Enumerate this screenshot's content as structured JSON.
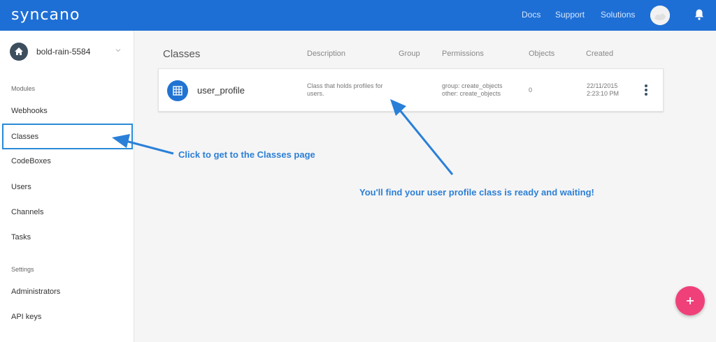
{
  "topbar": {
    "logo": "syncano",
    "nav": [
      "Docs",
      "Support",
      "Solutions"
    ]
  },
  "sidebar": {
    "instance_name": "bold-rain-5584",
    "modules_label": "Modules",
    "modules": [
      "Webhooks",
      "Classes",
      "CodeBoxes",
      "Users",
      "Channels",
      "Tasks"
    ],
    "active_item": "Classes",
    "settings_label": "Settings",
    "settings": [
      "Administrators",
      "API keys"
    ]
  },
  "main": {
    "title": "Classes",
    "columns": {
      "description": "Description",
      "group": "Group",
      "permissions": "Permissions",
      "objects": "Objects",
      "created": "Created"
    },
    "rows": [
      {
        "name": "user_profile",
        "description_line1": "Class that holds profiles for",
        "description_line2": "users.",
        "permission_group": "group: create_objects",
        "permission_other": "other: create_objects",
        "objects": "0",
        "created_date": "22/11/2015",
        "created_time": "2:23:10 PM"
      }
    ]
  },
  "annotations": {
    "sidebar_note": "Click to get to the Classes page",
    "row_note": "You'll find your user profile class is ready and waiting!"
  },
  "colors": {
    "topbar": "#1e6fd5",
    "accent": "#2173d2",
    "fab": "#f0407a",
    "annotation": "#2c7fd6"
  },
  "icons": {
    "home": "home-icon",
    "table": "table-icon",
    "bell": "bell-icon",
    "kebab": "more-vert-icon",
    "add": "plus-icon"
  }
}
